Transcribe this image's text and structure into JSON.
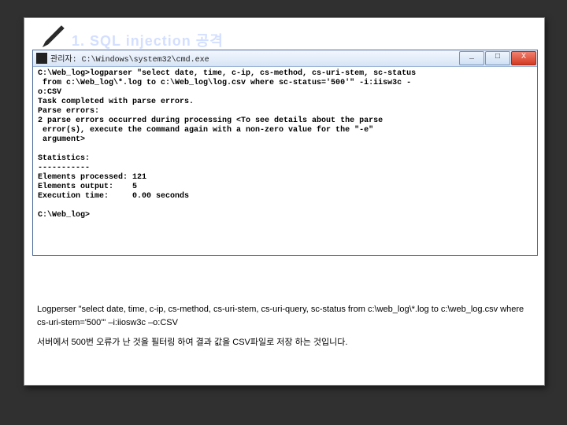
{
  "title": "1. SQL injection 공격",
  "window": {
    "title_prefix": "관리자:",
    "title_path": "C:\\Windows\\system32\\cmd.exe",
    "btn_min": "_",
    "btn_max": "□",
    "btn_close": "X"
  },
  "terminal": {
    "l1": "C:\\Web_log>logparser \"select date, time, c-ip, cs-method, cs-uri-stem, sc-status",
    "l2": " from c:\\Web_log\\*.log to c:\\Web_log\\log.csv where sc-status='500'\" -i:iisw3c -",
    "l3": "o:CSV",
    "l4": "Task completed with parse errors.",
    "l5": "Parse errors:",
    "l6": "2 parse errors occurred during processing <To see details about the parse",
    "l7": " error(s), execute the command again with a non-zero value for the \"-e\"",
    "l8": " argument>",
    "l9": "",
    "l10": "Statistics:",
    "l11": "-----------",
    "l12": "Elements processed: 121",
    "l13": "Elements output:    5",
    "l14": "Execution time:     0.00 seconds",
    "l15": "",
    "l16": "C:\\Web_log>"
  },
  "caption1": "Logperser \"select date, time, c-ip, cs-method, cs-uri-stem, cs-uri-query, sc-status from c:\\web_log\\*.log to c:\\web_log.csv where cs-uri-stem='500'\" –i:iiosw3c –o:CSV",
  "caption2": "서버에서 500번 오류가 난 것을 필터링 하여 결과 값을 CSV파일로 저장 하는 것입니다."
}
